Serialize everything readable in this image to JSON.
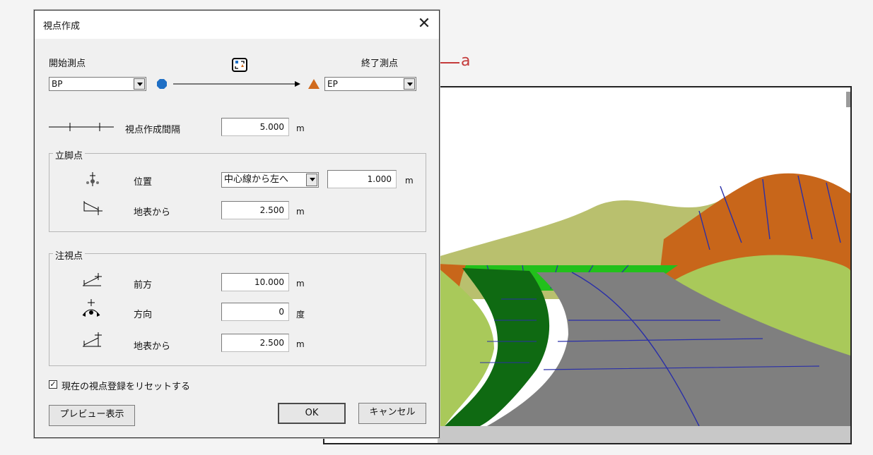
{
  "annotation": {
    "label": "a"
  },
  "dialog": {
    "title": "視点作成",
    "close_glyph": "✕",
    "start_label": "開始測点",
    "end_label": "終了測点",
    "start_station": "BP",
    "end_station": "EP",
    "interval_label": "視点作成間隔",
    "interval_value": "5.000",
    "interval_unit": "m",
    "standing": {
      "title": "立脚点",
      "position_label": "位置",
      "position_option": "中心線から左へ",
      "position_value": "1.000",
      "position_unit": "m",
      "height_label": "地表から",
      "height_value": "2.500",
      "height_unit": "m"
    },
    "gaze": {
      "title": "注視点",
      "forward_label": "前方",
      "forward_value": "10.000",
      "forward_unit": "m",
      "direction_label": "方向",
      "direction_value": "0",
      "direction_unit": "度",
      "height_label": "地表から",
      "height_value": "2.500",
      "height_unit": "m"
    },
    "reset_checkbox": {
      "label": "現在の視点登録をリセットする",
      "checked": true,
      "mark": "✓"
    },
    "preview_button": "プレビュー表示",
    "ok_button": "OK",
    "cancel_button": "キャンセル"
  },
  "colors": {
    "start_marker": "#1f6fc5",
    "end_marker": "#d06a1d",
    "annotation": "#c43a3a",
    "road": "#7f7f7f",
    "grass_light": "#a9c95a",
    "grass_dark": "#0f6a12",
    "slope_orange": "#c8661a",
    "slope_green": "#22c01b"
  },
  "icons": [
    "swap-icon",
    "start-marker-icon",
    "end-marker-icon",
    "interval-icon",
    "standing-position-icon",
    "standing-height-icon",
    "gaze-forward-icon",
    "gaze-direction-icon",
    "gaze-height-icon"
  ]
}
